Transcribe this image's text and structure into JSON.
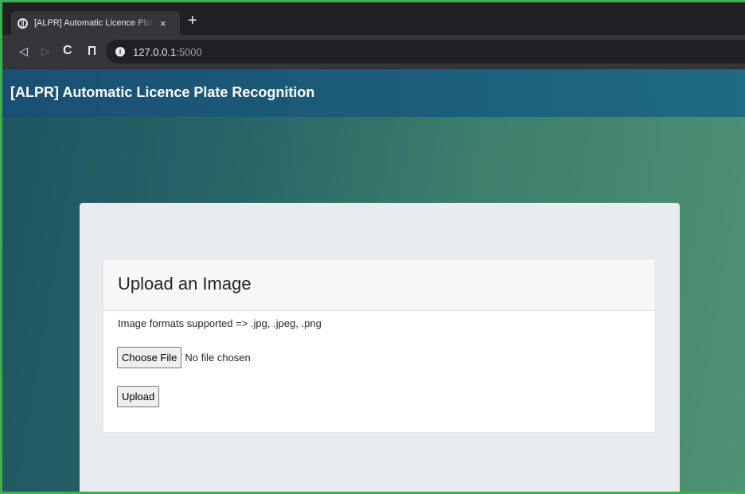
{
  "browser": {
    "tab": {
      "title": "[ALPR] Automatic Licence Plate Recognition",
      "close": "×"
    },
    "new_tab": "+",
    "nav": {
      "back": "◁",
      "forward": "▷",
      "reload": "C"
    },
    "address": {
      "host": "127.0.0.1",
      "port": ":5000"
    }
  },
  "page": {
    "brand": "[ALPR] Automatic Licence Plate Recognition",
    "card": {
      "title": "Upload an Image",
      "formats": "Image formats supported => .jpg, .jpeg, .png",
      "choose_file_label": "Choose File",
      "file_status": "No file chosen",
      "upload_label": "Upload"
    }
  },
  "colors": {
    "navbar": "#1a4f73",
    "frame": "#3fae52",
    "jumbotron": "#e9ecef"
  }
}
